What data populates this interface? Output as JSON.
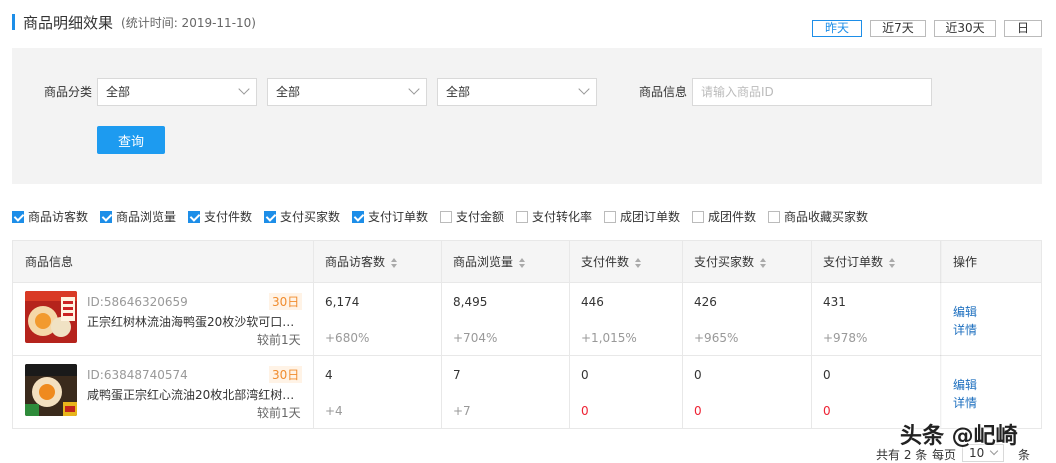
{
  "header": {
    "title": "商品明细效果",
    "subtitle": "(统计时间: 2019-11-10)",
    "ranges": [
      "昨天",
      "近7天",
      "近30天",
      "日"
    ]
  },
  "filter": {
    "category_label": "商品分类",
    "selects": [
      "全部",
      "全部",
      "全部"
    ],
    "info_label": "商品信息",
    "info_placeholder": "请输入商品ID",
    "query_label": "查询"
  },
  "metrics": [
    {
      "label": "商品访客数",
      "checked": true
    },
    {
      "label": "商品浏览量",
      "checked": true
    },
    {
      "label": "支付件数",
      "checked": true
    },
    {
      "label": "支付买家数",
      "checked": true
    },
    {
      "label": "支付订单数",
      "checked": true
    },
    {
      "label": "支付金额",
      "checked": false
    },
    {
      "label": "支付转化率",
      "checked": false
    },
    {
      "label": "成团订单数",
      "checked": false
    },
    {
      "label": "成团件数",
      "checked": false
    },
    {
      "label": "商品收藏买家数",
      "checked": false
    }
  ],
  "table": {
    "headers": [
      "商品信息",
      "商品访客数",
      "商品浏览量",
      "支付件数",
      "支付买家数",
      "支付订单数",
      "操作"
    ],
    "rows": [
      {
        "id": "ID:58646320659",
        "days": "30日",
        "name": "正宗红树林流油海鸭蛋20枚沙软可口咸…",
        "compare": "较前1天",
        "values": [
          "6,174",
          "8,495",
          "446",
          "426",
          "431"
        ],
        "changes": [
          "+680%",
          "+704%",
          "+1,015%",
          "+965%",
          "+978%"
        ],
        "actions": [
          "编辑",
          "详情"
        ]
      },
      {
        "id": "ID:63848740574",
        "days": "30日",
        "name": "咸鸭蛋正宗红心流油20枚北部湾红树林…",
        "compare": "较前1天",
        "values": [
          "4",
          "7",
          "0",
          "0",
          "0"
        ],
        "changes": [
          "+4",
          "+7",
          "0",
          "0",
          "0"
        ],
        "actions": [
          "编辑",
          "详情"
        ]
      }
    ]
  },
  "pagination": {
    "total_text": "共有 2 条",
    "per_page_label": "每页",
    "per_page_value": "10",
    "unit": "条"
  },
  "watermark": "头条 @屺崎",
  "colors": {
    "accent": "#1d8ee8",
    "button": "#1d9bf0",
    "days_badge": "#f08c2e",
    "zero_change": "#e23333"
  }
}
